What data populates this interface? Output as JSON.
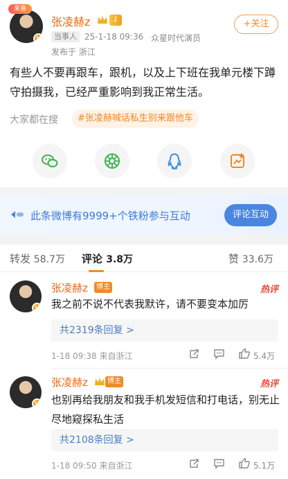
{
  "post": {
    "sticker_label": "来喜",
    "author": "张凌赫z",
    "level_label": "1",
    "role_tag": "当事人",
    "datetime": "25-1-18 09:36",
    "source": "众星时代演员",
    "location": "发布于 浙江",
    "follow_label": "+关注",
    "content": "有些人不要再跟车，跟机，以及上下班在我单元楼下蹲守拍摄我，已经严重影响到我正常生活。",
    "search_label": "大家都在搜",
    "hashtag": "#张凌赫喊话私生别来跟他车"
  },
  "share": {
    "icons": [
      "wechat-icon",
      "moments-icon",
      "qq-icon",
      "save-image-icon"
    ]
  },
  "promo": {
    "text": "此条微博有9999+个铁粉参与互动",
    "button": "评论互动"
  },
  "tabs": {
    "repost_label": "转发",
    "repost_count": "58.7万",
    "comment_label": "评论",
    "comment_count": "3.8万",
    "like_label": "赞",
    "like_count": "33.6万"
  },
  "comments": [
    {
      "author": "张凌赫z",
      "badge": "博主",
      "hot": "热评",
      "text": "我之前不说不代表我默许，请不要变本加厉",
      "replies": "共2319条回复 >",
      "meta": "1-18 09:38  来自浙江",
      "likes": "5.4万"
    },
    {
      "author": "张凌赫z",
      "badge": "博主",
      "hot": "热评",
      "text": "也别再给我朋友和我手机发短信和打电话，别无止尽地窥探私生活",
      "replies": "共2108条回复 >",
      "meta": "1-18 09:50  来自浙江",
      "likes": "5.1万"
    }
  ],
  "colors": {
    "accent_orange": "#f08a27",
    "name_orange": "#e86a15",
    "link_blue": "#4a7ec2",
    "promo_blue": "#4a86e0",
    "hot_red": "#e84b3b"
  }
}
